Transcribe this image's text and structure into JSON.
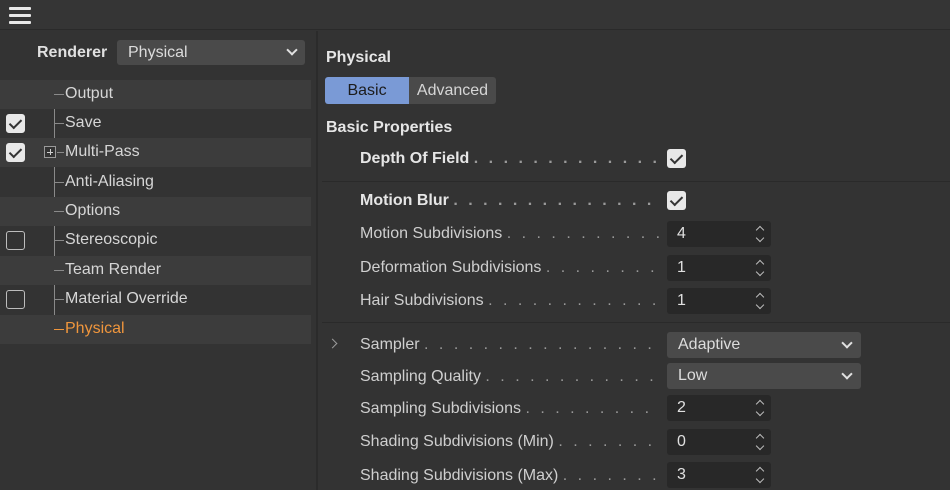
{
  "menu_icon": "hamburger-menu-icon",
  "renderer": {
    "label": "Renderer",
    "value": "Physical"
  },
  "tree": [
    {
      "label": "Output",
      "checkbox": null
    },
    {
      "label": "Save",
      "checkbox": true
    },
    {
      "label": "Multi-Pass",
      "checkbox": true,
      "expandable": true
    },
    {
      "label": "Anti-Aliasing",
      "checkbox": null
    },
    {
      "label": "Options",
      "checkbox": null
    },
    {
      "label": "Stereoscopic",
      "checkbox": false
    },
    {
      "label": "Team Render",
      "checkbox": null
    },
    {
      "label": "Material Override",
      "checkbox": false
    },
    {
      "label": "Physical",
      "checkbox": null,
      "active": true
    }
  ],
  "panel": {
    "title": "Physical",
    "tabs": [
      "Basic",
      "Advanced"
    ],
    "active_tab": "Basic",
    "section": "Basic Properties"
  },
  "props": {
    "depth_of_field": {
      "label": "Depth Of Field",
      "checked": true
    },
    "motion_blur": {
      "label": "Motion Blur",
      "checked": true
    },
    "motion_subdivisions": {
      "label": "Motion Subdivisions",
      "value": "4"
    },
    "deformation_subdivisions": {
      "label": "Deformation Subdivisions",
      "value": "1"
    },
    "hair_subdivisions": {
      "label": "Hair Subdivisions",
      "value": "1"
    },
    "sampler": {
      "label": "Sampler",
      "value": "Adaptive"
    },
    "sampling_quality": {
      "label": "Sampling Quality",
      "value": "Low"
    },
    "sampling_subdivisions": {
      "label": "Sampling Subdivisions",
      "value": "2"
    },
    "shading_min": {
      "label": "Shading Subdivisions (Min)",
      "value": "0"
    },
    "shading_max": {
      "label": "Shading Subdivisions (Max)",
      "value": "3"
    }
  },
  "colors": {
    "accent_tab": "#7a9ad6",
    "active_item": "#f0963c"
  }
}
